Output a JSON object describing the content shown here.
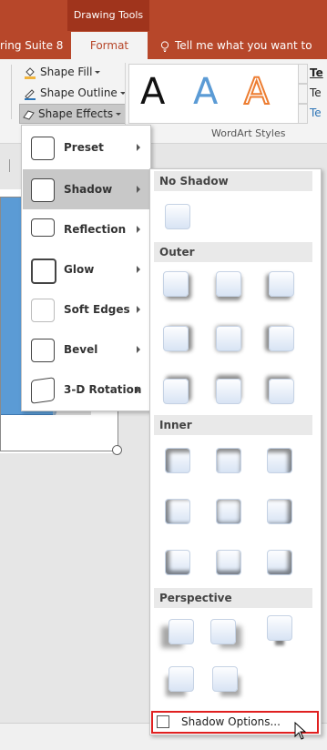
{
  "titlebar": {
    "context_tab": "Drawing Tools"
  },
  "tabs": {
    "cut_tab": "ring Suite 8",
    "format_tab": "Format",
    "tell_me": "Tell me what you want to do"
  },
  "ribbon": {
    "shape_fill": "Shape Fill",
    "shape_outline": "Shape Outline",
    "shape_effects": "Shape Effects",
    "wordart_letter": "A",
    "wordart_group_label": "WordArt Styles",
    "text_cut": "Te"
  },
  "effects_menu": {
    "items": [
      {
        "label": "Preset"
      },
      {
        "label": "Shadow"
      },
      {
        "label": "Reflection"
      },
      {
        "label": "Glow"
      },
      {
        "label": "Soft Edges"
      },
      {
        "label": "Bevel"
      },
      {
        "label": "3-D Rotation"
      }
    ],
    "selected": "Shadow"
  },
  "shadow_menu": {
    "sections": {
      "no_shadow": "No Shadow",
      "outer": "Outer",
      "inner": "Inner",
      "perspective": "Perspective"
    },
    "options": "Shadow Options..."
  },
  "colors": {
    "accent": "#b7472a",
    "wordart_blue": "#5b9bd5",
    "wordart_orange": "#ed7d31",
    "highlight_red": "#e02020"
  }
}
